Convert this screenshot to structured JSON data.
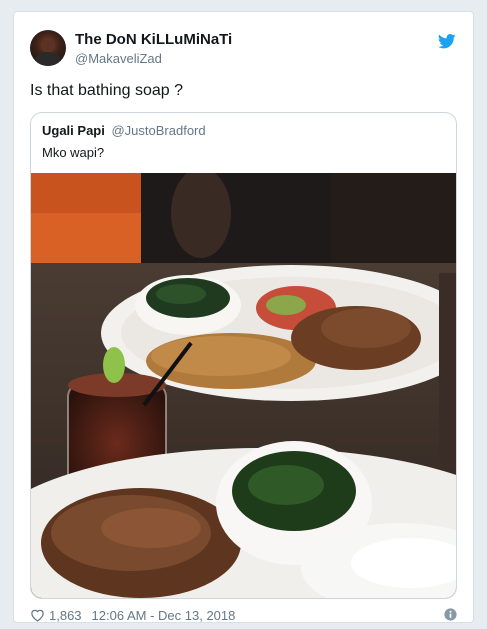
{
  "tweet": {
    "display_name": "The DoN KiLLuMiNaTi",
    "handle": "@MakaveliZad",
    "text": "Is that bathing soap ?",
    "likes": "1,863",
    "timestamp": "12:06 AM - Dec 13, 2018"
  },
  "quoted_tweet": {
    "display_name": "Ugali Papi",
    "handle": "@JustoBradford",
    "text": "Mko wapi?"
  },
  "icons": {
    "brand": "twitter-bird-icon",
    "like": "heart-icon",
    "info": "info-icon"
  },
  "colors": {
    "twitter_blue": "#1da1f2",
    "secondary_text": "#657786",
    "primary_text": "#14171a",
    "border": "#ccd6dd"
  }
}
